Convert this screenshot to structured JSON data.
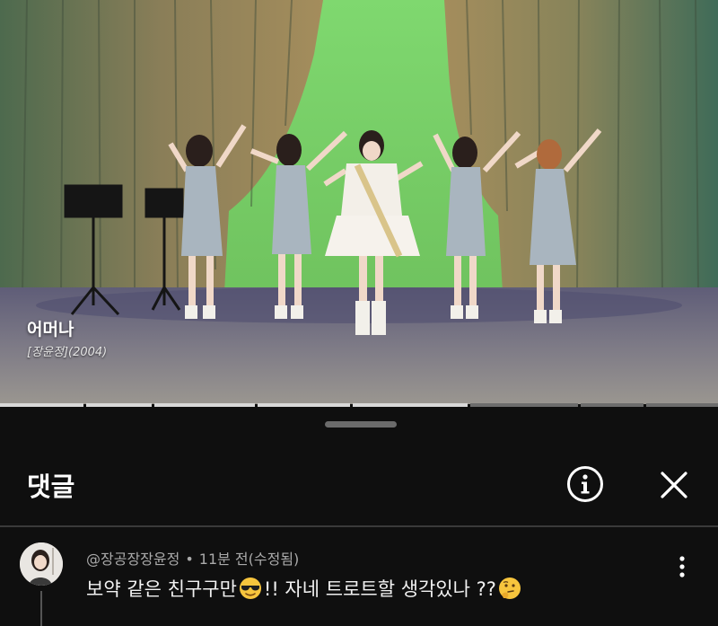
{
  "video": {
    "caption_title": "어머나",
    "caption_subtitle": "[장윤정](2004)",
    "chapters": [
      {
        "state": "played"
      },
      {
        "state": "played"
      },
      {
        "state": "played"
      },
      {
        "state": "played"
      },
      {
        "state": "played"
      },
      {
        "state": "current"
      },
      {
        "state": "upcoming"
      },
      {
        "state": "upcoming"
      }
    ]
  },
  "comments_panel": {
    "title": "댓글",
    "info_icon": "info-icon",
    "close_icon": "close-icon"
  },
  "comment": {
    "author": "@장공장장윤정",
    "time": "11분 전(수정됨)",
    "text_before": "보약 같은 친구구만",
    "emoji_1": "smiling-face-with-sunglasses-emoji",
    "text_middle": "!! 자네 트로트할 생각있나 ??",
    "emoji_2": "thinking-face-emoji",
    "more_icon": "more-vert-icon"
  },
  "colors": {
    "background": "#0f0f0f",
    "meta_text": "#aaaaaa",
    "divider": "#3a3a3a"
  }
}
